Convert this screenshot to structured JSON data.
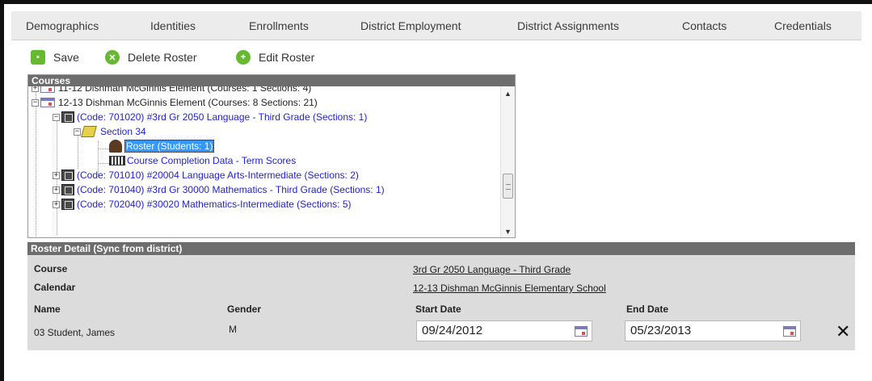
{
  "tabs": [
    "Demographics",
    "Identities",
    "Enrollments",
    "District Employment",
    "District Assignments",
    "Contacts",
    "Credentials"
  ],
  "toolbar": {
    "save_label": "Save",
    "delete_label": "Delete Roster",
    "edit_label": "Edit Roster"
  },
  "courses_panel": {
    "title": "Courses",
    "rows": [
      "11-12 Dishman McGinnis Element (Courses: 1 Sections: 4)",
      "12-13 Dishman McGinnis Element (Courses: 8 Sections: 21)",
      "(Code: 701020) #3rd Gr 2050 Language - Third Grade (Sections: 1)",
      "Section 34",
      "Roster (Students: 1)",
      "Course Completion Data - Term Scores",
      "(Code: 701010) #20004 Language Arts-Intermediate (Sections: 2)",
      "(Code: 701040) #3rd Gr 30000 Mathematics - Third Grade (Sections: 1)",
      "(Code: 702040) #30020 Mathematics-Intermediate (Sections: 5)"
    ]
  },
  "roster_detail": {
    "title": "Roster Detail (Sync from district)",
    "course_label": "Course",
    "course_value": "3rd Gr 2050 Language - Third Grade",
    "calendar_label": "Calendar",
    "calendar_value": "12-13 Dishman McGinnis Elementary School",
    "name_header": "Name",
    "gender_header": "Gender",
    "start_header": "Start Date",
    "end_header": "End Date",
    "student_name": "03 Student, James",
    "student_gender": "M",
    "start_date": "09/24/2012",
    "end_date": "05/23/2013",
    "remove_glyph": "✕"
  },
  "colors": {
    "accent_green": "#67b932",
    "panel_header": "#6d6d6d",
    "detail_bg": "#dcdcdc",
    "tree_link": "#1f1fd0",
    "selection": "#3399ff"
  }
}
